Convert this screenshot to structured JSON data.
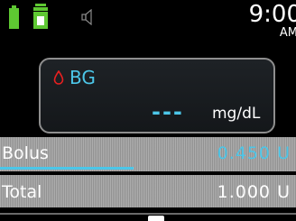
{
  "status": {
    "time": "9:00",
    "ampm": "AM",
    "battery_color": "#5ec832",
    "reservoir_color": "#5ec832"
  },
  "bg_panel": {
    "label": "BG",
    "value": "---",
    "unit": "mg/dL",
    "accent_color": "#4cc6e8",
    "drop_color": "#e82020"
  },
  "bolus": {
    "label": "Bolus",
    "value": "0.450",
    "unit": "U",
    "progress_fraction": 0.45
  },
  "total": {
    "label": "Total",
    "value": "1.000",
    "unit": "U"
  },
  "icons": {
    "battery": "battery-icon",
    "reservoir": "reservoir-icon",
    "speaker": "speaker-icon",
    "drop": "blood-drop-icon"
  }
}
